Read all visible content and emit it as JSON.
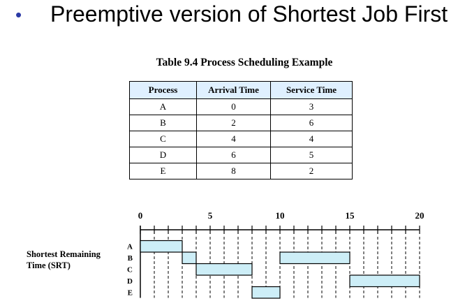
{
  "slide": {
    "bullet": "•",
    "heading": "Preemptive version of Shortest Job First"
  },
  "table": {
    "caption": "Table 9.4 Process Scheduling Example",
    "headers": [
      "Process",
      "Arrival Time",
      "Service Time"
    ],
    "rows": [
      [
        "A",
        "0",
        "3"
      ],
      [
        "B",
        "2",
        "6"
      ],
      [
        "C",
        "4",
        "4"
      ],
      [
        "D",
        "6",
        "5"
      ],
      [
        "E",
        "8",
        "2"
      ]
    ]
  },
  "gantt": {
    "label_line1": "Shortest Remaining",
    "label_line2": "Time (SRT)",
    "axis_ticks": [
      "0",
      "5",
      "10",
      "15",
      "20"
    ],
    "processes": [
      "A",
      "B",
      "C",
      "D",
      "E"
    ],
    "segments": [
      {
        "process": "A",
        "start": 0,
        "end": 3
      },
      {
        "process": "B",
        "start": 3,
        "end": 4
      },
      {
        "process": "C",
        "start": 4,
        "end": 8
      },
      {
        "process": "E",
        "start": 8,
        "end": 10
      },
      {
        "process": "B",
        "start": 10,
        "end": 15
      },
      {
        "process": "D",
        "start": 15,
        "end": 20
      }
    ],
    "colors": {
      "bar": "#cdeef7",
      "bar_border": "#000000"
    }
  }
}
